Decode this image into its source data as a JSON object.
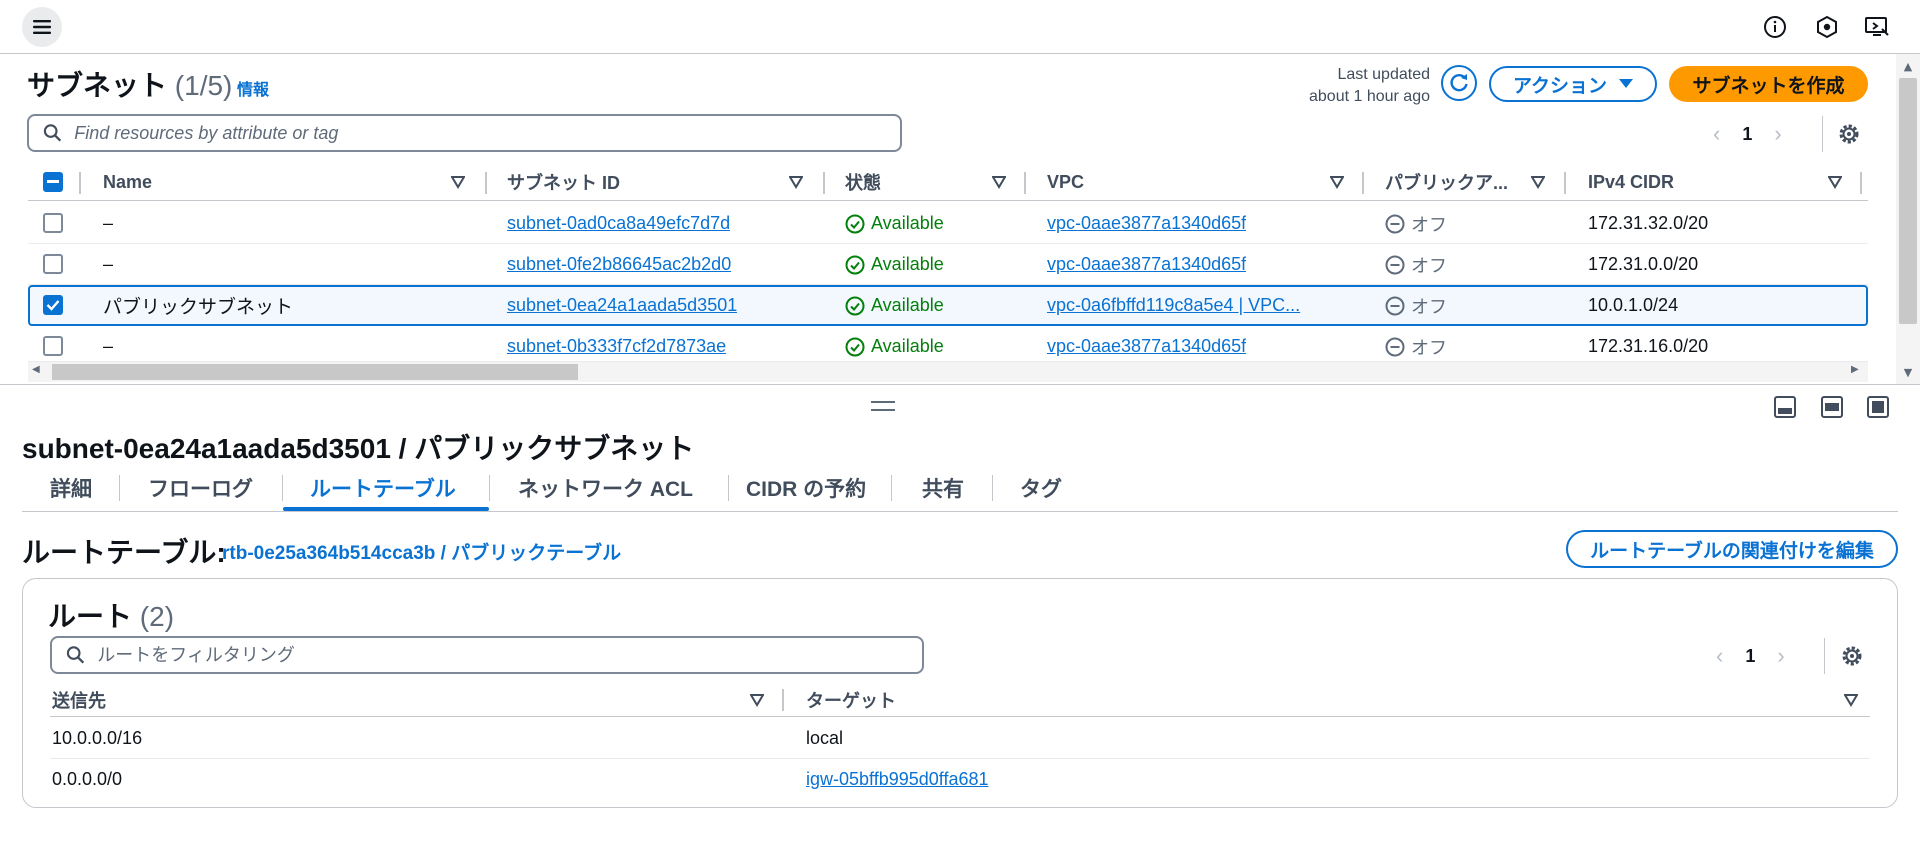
{
  "header_icons": [
    "menu-icon",
    "info-circle-icon",
    "notification-icon",
    "remote-display-icon"
  ],
  "subnets": {
    "title": "サブネット",
    "count": "(1/5)",
    "info_link": "情報",
    "last_updated_line1": "Last updated",
    "last_updated_line2": "about 1 hour ago",
    "actions_label": "アクション",
    "create_label": "サブネットを作成",
    "search_placeholder": "Find resources by attribute or tag",
    "page": "1",
    "columns": {
      "name": "Name",
      "subnet_id": "サブネット ID",
      "state": "状態",
      "vpc": "VPC",
      "public": "パブリックア...",
      "cidr": "IPv4 CIDR"
    },
    "rows": [
      {
        "name": "–",
        "subnet_id": "subnet-0ad0ca8a49efc7d7d",
        "state": "Available",
        "vpc": "vpc-0aae3877a1340d65f",
        "public": "オフ",
        "cidr": "172.31.32.0/20",
        "selected": false
      },
      {
        "name": "–",
        "subnet_id": "subnet-0fe2b86645ac2b2d0",
        "state": "Available",
        "vpc": "vpc-0aae3877a1340d65f",
        "public": "オフ",
        "cidr": "172.31.0.0/20",
        "selected": false
      },
      {
        "name": "パブリックサブネット",
        "subnet_id": "subnet-0ea24a1aada5d3501",
        "state": "Available",
        "vpc": "vpc-0a6fbffd119c8a5e4 | VPC...",
        "public": "オフ",
        "cidr": "10.0.1.0/24",
        "selected": true
      },
      {
        "name": "–",
        "subnet_id": "subnet-0b333f7cf2d7873ae",
        "state": "Available",
        "vpc": "vpc-0aae3877a1340d65f",
        "public": "オフ",
        "cidr": "172.31.16.0/20",
        "selected": false
      }
    ]
  },
  "detail": {
    "title": "subnet-0ea24a1aada5d3501 / パブリックサブネット",
    "tabs": [
      "詳細",
      "フローログ",
      "ルートテーブル",
      "ネットワーク ACL",
      "CIDR の予約",
      "共有",
      "タグ"
    ],
    "active_tab": "ルートテーブル",
    "route_table_label": "ルートテーブル:",
    "route_table_link": "rtb-0e25a364b514cca3b / パブリックテーブル",
    "edit_assoc_label": "ルートテーブルの関連付けを編集",
    "routes": {
      "title": "ルート",
      "count": "(2)",
      "filter_placeholder": "ルートをフィルタリング",
      "page": "1",
      "col_destination": "送信先",
      "col_target": "ターゲット",
      "rows": [
        {
          "destination": "10.0.0.0/16",
          "target": "local",
          "target_is_link": false
        },
        {
          "destination": "0.0.0.0/0",
          "target": "igw-05bffb995d0ffa681",
          "target_is_link": true
        }
      ]
    }
  },
  "colors": {
    "accent": "#0972d3",
    "primary_button": "#ff9900",
    "success": "#037f0c",
    "muted": "#5f6b7a"
  }
}
